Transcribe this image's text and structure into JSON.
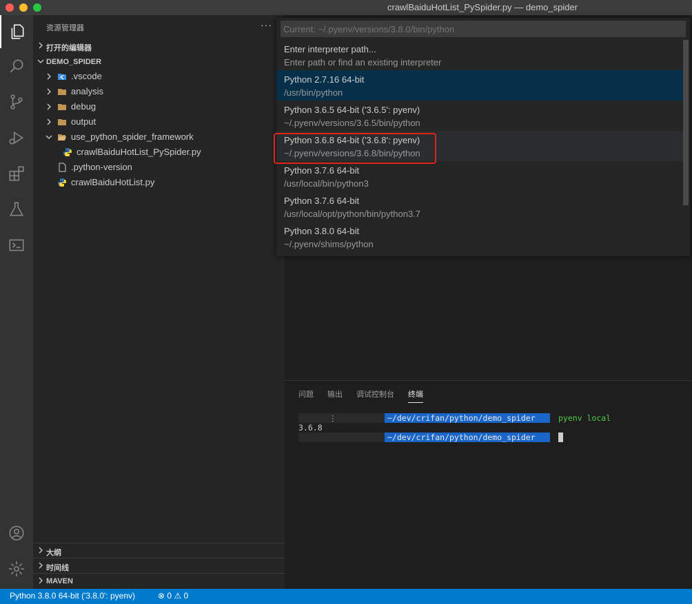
{
  "window": {
    "title": "crawlBaiduHotList_PySpider.py — demo_spider"
  },
  "explorer": {
    "header": "资源管理器",
    "more": "···",
    "open_editors": "打开的编辑器",
    "workspace": "DEMO_SPIDER",
    "items": [
      {
        "name": ".vscode",
        "type": "folder-vscode"
      },
      {
        "name": "analysis",
        "type": "folder"
      },
      {
        "name": "debug",
        "type": "folder"
      },
      {
        "name": "output",
        "type": "folder"
      },
      {
        "name": "use_python_spider_framework",
        "type": "folder-open"
      },
      {
        "name": "crawlBaiduHotList_PySpider.py",
        "type": "python"
      },
      {
        "name": ".python-version",
        "type": "file"
      },
      {
        "name": "crawlBaiduHotList.py",
        "type": "python"
      }
    ],
    "bottom_sections": [
      "大纲",
      "时间线",
      "MAVEN"
    ]
  },
  "quick_pick": {
    "placeholder": "Current: ~/.pyenv/versions/3.8.0/bin/python",
    "items": [
      {
        "label": "Enter interpreter path...",
        "detail": "Enter path or find an existing interpreter"
      },
      {
        "label": "Python 2.7.16 64-bit",
        "detail": "/usr/bin/python"
      },
      {
        "label": "Python 3.6.5 64-bit ('3.6.5': pyenv)",
        "detail": "~/.pyenv/versions/3.6.5/bin/python"
      },
      {
        "label": "Python 3.6.8 64-bit ('3.6.8': pyenv)",
        "detail": "~/.pyenv/versions/3.6.8/bin/python"
      },
      {
        "label": "Python 3.7.6 64-bit",
        "detail": "/usr/local/bin/python3"
      },
      {
        "label": "Python 3.7.6 64-bit",
        "detail": "/usr/local/opt/python/bin/python3.7"
      },
      {
        "label": "Python 3.8.0 64-bit",
        "detail": "~/.pyenv/shims/python"
      }
    ]
  },
  "panel": {
    "tabs": [
      "问题",
      "输出",
      "调试控制台",
      "终端"
    ],
    "terminal": {
      "path": "~/dev/crifan/python/demo_spider",
      "command": "pyenv local",
      "output": "3.6.8",
      "marker": "⋮"
    }
  },
  "status_bar": {
    "interpreter": "Python 3.8.0 64-bit ('3.8.0': pyenv)",
    "errors": "0",
    "warnings": "0"
  },
  "colors": {
    "accent": "#007acc",
    "selection": "#062f4a",
    "highlight_box": "#e0241b",
    "terminal_path": "#1a66c8",
    "terminal_command": "#4ec94e"
  }
}
